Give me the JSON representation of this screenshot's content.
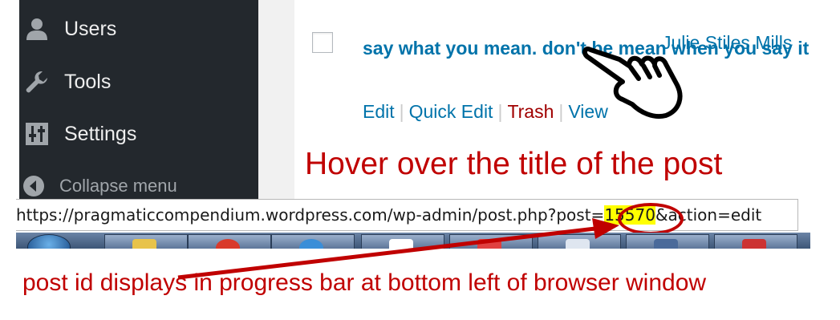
{
  "sidebar": {
    "items": [
      {
        "label": "Users",
        "icon": "user-icon"
      },
      {
        "label": "Tools",
        "icon": "wrench-icon"
      },
      {
        "label": "Settings",
        "icon": "settings-sliders-icon"
      }
    ],
    "collapse_label": "Collapse menu"
  },
  "post": {
    "title": "say what you mean. don't be mean when you say it",
    "author": "Julie Stiles Mills",
    "actions": {
      "edit": "Edit",
      "quick_edit": "Quick Edit",
      "trash": "Trash",
      "view": "View"
    }
  },
  "annotations": {
    "hover_callout": "Hover over the title of the post",
    "bottom_callout": "post id displays in progress bar at bottom left of browser window",
    "color": "#c00000"
  },
  "statusbar": {
    "url_prefix": "https://pragmaticcompendium.wordpress.com/wp-admin/post.php?post=",
    "post_id": "15570",
    "url_suffix": "&action=edit"
  },
  "colors": {
    "sidebar_bg": "#23282d",
    "link": "#0073aa",
    "trash": "#a00000",
    "highlight": "#ffff00"
  }
}
